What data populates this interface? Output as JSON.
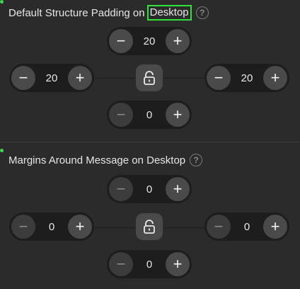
{
  "sections": [
    {
      "title_prefix": "Default Structure Padding on",
      "title_highlight": "Desktop",
      "help_glyph": "?",
      "top": {
        "value": "20",
        "minus": "−",
        "plus": "+"
      },
      "left": {
        "value": "20",
        "minus": "−",
        "plus": "+"
      },
      "right": {
        "value": "20",
        "minus": "−",
        "plus": "+"
      },
      "bottom": {
        "value": "0",
        "minus": "−",
        "plus": "+"
      }
    },
    {
      "title": "Margins Around Message on Desktop",
      "help_glyph": "?",
      "top": {
        "value": "0",
        "minus": "−",
        "plus": "+"
      },
      "left": {
        "value": "0",
        "minus": "−",
        "plus": "+"
      },
      "right": {
        "value": "0",
        "minus": "−",
        "plus": "+"
      },
      "bottom": {
        "value": "0",
        "minus": "−",
        "plus": "+"
      }
    }
  ],
  "icons": {
    "help": "question-circle-icon",
    "lock": "unlock-icon"
  },
  "colors": {
    "background": "#2b2b2b",
    "stepper_bg": "#1d1d1d",
    "button_bg": "#4a4a4a",
    "highlight": "#2fe13a",
    "status_dot": "#3dd64f"
  }
}
